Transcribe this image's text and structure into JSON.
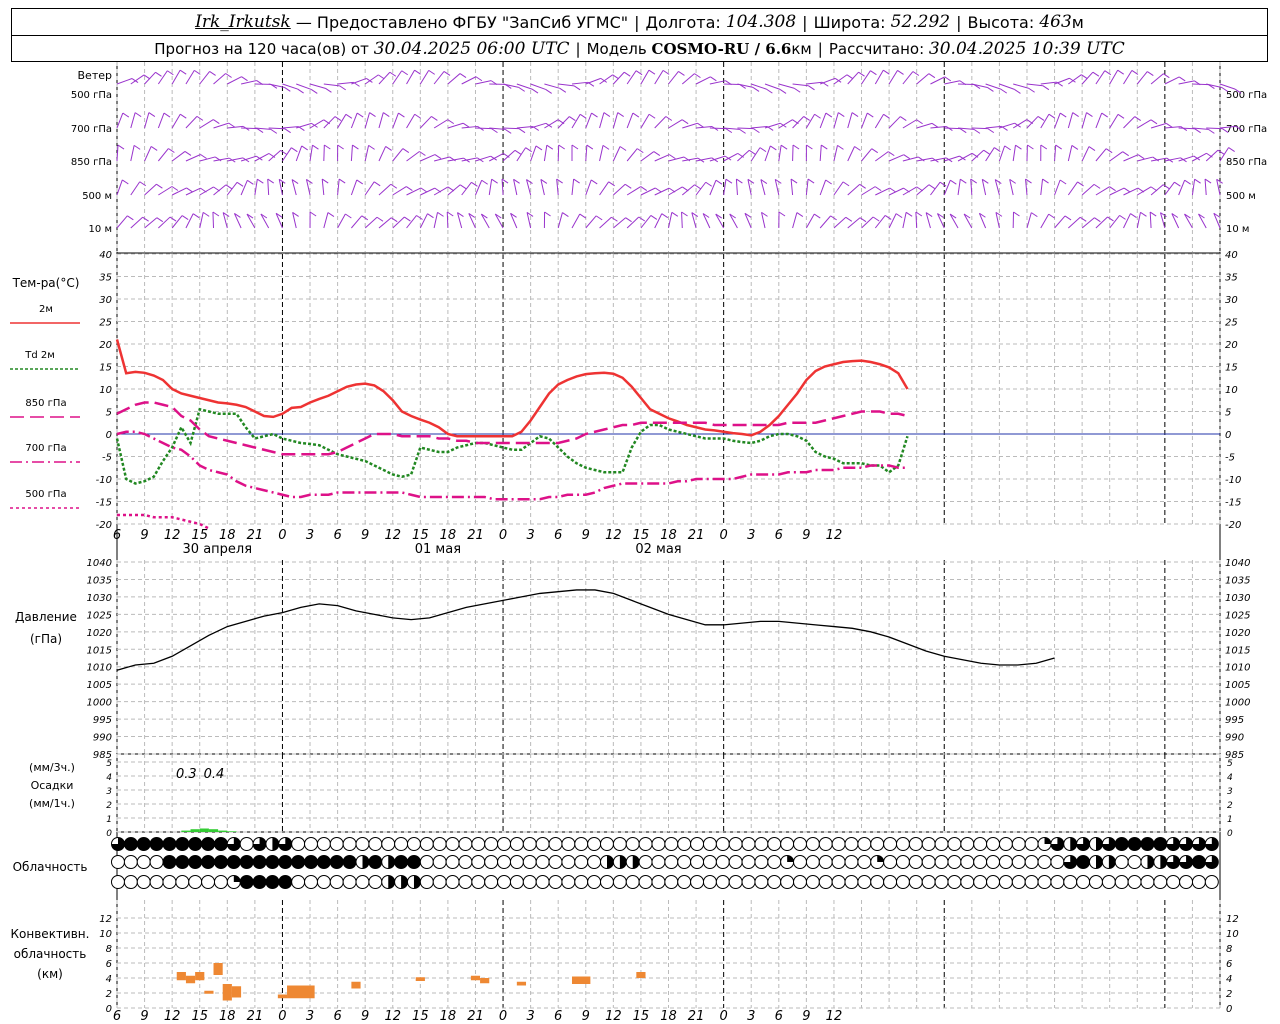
{
  "header": {
    "station": "Irk_Irkutsk",
    "sep1": " — ",
    "provider": "Предоставлено ФГБУ \"ЗапСиб УГМС\"",
    "lon_label": "Долгота:",
    "lon_value": "104.308",
    "lat_label": "Широта:",
    "lat_value": "52.292",
    "alt_label": "Высота:",
    "alt_value": "463",
    "alt_unit": "м",
    "forecast_label": "Прогноз на 120 часа(ов) от",
    "forecast_start": "30.04.2025 06:00 UTC",
    "model_label": "Модель",
    "model_name": "COSMO-RU / 6.6",
    "model_unit": "км",
    "computed_label": "Рассчитано:",
    "computed_time": "30.04.2025 10:39 UTC"
  },
  "time_axis": {
    "hour_labels": [
      "6",
      "9",
      "12",
      "15",
      "18",
      "21",
      "0",
      "3",
      "6",
      "9",
      "12",
      "15",
      "18",
      "21",
      "0",
      "3",
      "6",
      "9",
      "12",
      "15",
      "18",
      "21",
      "0",
      "3",
      "6",
      "9",
      "12"
    ],
    "day_labels": [
      "30 апреля",
      "01 мая",
      "02 мая"
    ]
  },
  "wind_panel": {
    "title": "Ветер",
    "levels": [
      "500 гПа",
      "700 гПа",
      "850 гПа",
      "500 м",
      "10 м"
    ],
    "colors": {
      "barb": "#9933cc"
    }
  },
  "chart_data": [
    {
      "type": "line",
      "title": "Тем-ра(°C)",
      "x_hours": [
        6,
        7,
        8,
        9,
        10,
        11,
        12,
        13,
        14,
        15,
        16,
        17,
        18,
        19,
        20,
        21,
        22,
        23,
        24,
        25,
        26,
        27,
        28,
        29,
        30,
        31,
        32,
        33,
        34,
        35,
        36,
        37,
        38,
        39,
        40,
        41,
        42,
        43,
        44,
        45,
        46,
        47,
        48,
        49,
        50,
        51,
        52,
        53,
        54,
        55,
        56,
        57,
        58,
        59,
        60,
        61,
        62,
        63,
        64,
        65,
        66,
        67,
        68,
        69,
        70,
        71,
        72,
        73,
        74,
        75,
        76,
        77,
        78,
        79,
        80,
        81,
        82,
        83,
        84,
        85,
        86,
        87,
        88,
        89,
        90,
        91,
        92,
        93,
        94,
        95,
        96,
        97,
        98,
        99,
        100,
        101,
        102,
        103,
        104,
        105,
        106,
        107,
        108,
        109,
        110,
        111,
        112,
        113,
        114,
        115,
        116,
        117,
        118,
        119,
        120,
        121,
        122,
        123,
        124,
        125,
        126
      ],
      "ylim": [
        -20,
        40
      ],
      "yticks": [
        -20,
        -15,
        -10,
        -5,
        0,
        5,
        10,
        15,
        20,
        25,
        30,
        35,
        40
      ],
      "series": [
        {
          "name": "2м",
          "color": "#ee3333",
          "dash": "solid",
          "values": [
            21,
            13.5,
            13.8,
            13.6,
            13,
            12,
            10,
            9,
            8.5,
            8,
            7.5,
            7,
            6.8,
            6.5,
            6,
            5,
            4,
            3.8,
            4.5,
            5.8,
            6,
            7,
            7.8,
            8.5,
            9.5,
            10.5,
            11,
            11.2,
            10.8,
            9.5,
            7.5,
            5,
            4,
            3.2,
            2.5,
            1.5,
            0,
            -0.5,
            -0.5,
            -0.5,
            -0.5,
            -0.5,
            -0.5,
            -0.5,
            0.5,
            3,
            6,
            9,
            11,
            12,
            12.8,
            13.3,
            13.5,
            13.6,
            13.4,
            12.5,
            10.5,
            8,
            5.5,
            4.5,
            3.5,
            2.8,
            2,
            1.5,
            1,
            0.8,
            0.5,
            0.2,
            0,
            -0.3,
            0.5,
            2,
            4,
            6.5,
            9,
            12,
            14,
            15,
            15.5,
            16,
            16.2,
            16.3,
            16,
            15.5,
            14.8,
            13.5,
            10
          ]
        },
        {
          "name": "Td 2м",
          "color": "#228822",
          "dash": "3,2",
          "values": [
            -1,
            -10,
            -11,
            -10.5,
            -9.5,
            -6,
            -3,
            1.5,
            -2,
            5.5,
            5,
            4.5,
            4.5,
            4.5,
            1.5,
            -1,
            -0.5,
            0,
            -1,
            -1.5,
            -2,
            -2.2,
            -2.5,
            -3.5,
            -4.5,
            -5,
            -5.5,
            -6,
            -7,
            -8,
            -9,
            -9.5,
            -9,
            -3,
            -3.5,
            -4,
            -4,
            -3,
            -2.5,
            -2,
            -2,
            -2.5,
            -3,
            -3.5,
            -3.5,
            -2,
            -0.5,
            -1,
            -3,
            -5,
            -6.5,
            -7.5,
            -8,
            -8.5,
            -8.5,
            -8.5,
            -3,
            0.5,
            2,
            2,
            1,
            0.5,
            0,
            -0.5,
            -1,
            -1,
            -1,
            -1.5,
            -1.8,
            -2,
            -1.5,
            -0.5,
            0,
            0,
            -0.5,
            -1.5,
            -4,
            -5,
            -5.5,
            -6.5,
            -6.5,
            -6.5,
            -7,
            -7,
            -8.5,
            -7,
            -0.5
          ]
        },
        {
          "name": "850 гПа",
          "color": "#dd1188",
          "dash": "14,6",
          "values": [
            4.5,
            5.5,
            6.5,
            7,
            7,
            6.5,
            6,
            4,
            3,
            1,
            -0.5,
            -1,
            -1.5,
            -2,
            -2.5,
            -3,
            -3.5,
            -4,
            -4.5,
            -4.5,
            -4.5,
            -4.5,
            -4.5,
            -4.5,
            -4,
            -3,
            -2,
            -1,
            0,
            0,
            0,
            -0.5,
            -0.5,
            -0.5,
            -0.5,
            -1,
            -1,
            -1.5,
            -1.5,
            -2,
            -2,
            -2,
            -2,
            -2,
            -2,
            -2,
            -2,
            -2,
            -2,
            -1.5,
            -1,
            0,
            0.5,
            1,
            1.5,
            2,
            2,
            2.5,
            2.5,
            2.5,
            2.5,
            2.5,
            2.5,
            2.5,
            2.5,
            2,
            2,
            2,
            2,
            2,
            2,
            2,
            2,
            2.5,
            2.5,
            2.5,
            2.5,
            3,
            3.5,
            4,
            4.5,
            5,
            5,
            5,
            4.5,
            4.5,
            4
          ]
        },
        {
          "name": "700 гПа",
          "color": "#dd1188",
          "dash": "12,4,2,4",
          "values": [
            0,
            0.5,
            0.5,
            0,
            -1,
            -2,
            -3,
            -3.5,
            -5,
            -7,
            -8,
            -8.5,
            -9,
            -10.5,
            -11.5,
            -12,
            -12.5,
            -13,
            -13.5,
            -14,
            -14,
            -13.5,
            -13.5,
            -13.5,
            -13,
            -13,
            -13,
            -13,
            -13,
            -13,
            -13,
            -13,
            -13.5,
            -14,
            -14,
            -14,
            -14,
            -14,
            -14,
            -14,
            -14,
            -14.5,
            -14.5,
            -14.5,
            -14.5,
            -14.5,
            -14.5,
            -14,
            -14,
            -13.5,
            -13.5,
            -13.5,
            -13,
            -12,
            -11.5,
            -11,
            -11,
            -11,
            -11,
            -11,
            -11,
            -10.5,
            -10.5,
            -10,
            -10,
            -10,
            -10,
            -10,
            -9.5,
            -9,
            -9,
            -9,
            -9,
            -8.5,
            -8.5,
            -8.5,
            -8,
            -8,
            -8,
            -7.5,
            -7.5,
            -7.5,
            -7,
            -7,
            -7,
            -7.5,
            -7.5
          ]
        },
        {
          "name": "500 гПа",
          "color": "#dd1188",
          "dash": "3,3",
          "values": [
            -18,
            -18,
            -18,
            -18,
            -18.5,
            -18.5,
            -18.5,
            -19,
            -19.5,
            -20,
            -21
          ]
        }
      ]
    },
    {
      "type": "line",
      "title": "Давление",
      "unit": "(гПа)",
      "x_hours": [
        6,
        8,
        10,
        12,
        14,
        16,
        18,
        20,
        22,
        24,
        26,
        28,
        30,
        32,
        34,
        36,
        38,
        40,
        42,
        44,
        46,
        48,
        50,
        52,
        54,
        56,
        58,
        60,
        62,
        64,
        66,
        68,
        70,
        72,
        74,
        76,
        78,
        80,
        82,
        84,
        86,
        88,
        90,
        92,
        94,
        96,
        98,
        100,
        102,
        104,
        106,
        108,
        110,
        112,
        114,
        116,
        118,
        120,
        122,
        124,
        126
      ],
      "ylim": [
        985,
        1040
      ],
      "yticks": [
        985,
        990,
        995,
        1000,
        1005,
        1010,
        1015,
        1020,
        1025,
        1030,
        1035,
        1040
      ],
      "series": [
        {
          "name": "",
          "color": "#000000",
          "values": [
            1009,
            1010.5,
            1011,
            1013,
            1016,
            1019,
            1021.5,
            1023,
            1024.5,
            1025.5,
            1027,
            1028,
            1027.5,
            1026,
            1025,
            1024,
            1023.5,
            1024,
            1025.5,
            1027,
            1028,
            1029,
            1030,
            1031,
            1031.5,
            1032,
            1032,
            1031,
            1029,
            1027,
            1025,
            1023.5,
            1022,
            1022,
            1022.5,
            1023,
            1023,
            1022.5,
            1022,
            1021.5,
            1021,
            1020,
            1018.5,
            1016.5,
            1014.5,
            1013,
            1012,
            1011,
            1010.5,
            1010.5,
            1011,
            1012.5
          ]
        }
      ]
    },
    {
      "type": "bar",
      "title": "Осадки",
      "unit_top": "(мм/3ч.)",
      "unit_bottom": "(мм/1ч.)",
      "ylim": [
        0,
        5
      ],
      "yticks": [
        0,
        1,
        2,
        3,
        4,
        5
      ],
      "labels": [
        {
          "hour": 13,
          "text": "0.3"
        },
        {
          "hour": 16,
          "text": "0.4"
        }
      ],
      "bars": [
        {
          "h1": 13,
          "h2": 14,
          "value": 0.1
        },
        {
          "h1": 14,
          "h2": 15,
          "value": 0.2
        },
        {
          "h1": 15,
          "h2": 16,
          "value": 0.25
        },
        {
          "h1": 16,
          "h2": 17,
          "value": 0.2
        },
        {
          "h1": 17,
          "h2": 18,
          "value": 0.1
        },
        {
          "h1": 18,
          "h2": 19,
          "value": 0.05
        }
      ],
      "color": "#33cc33"
    },
    {
      "type": "table",
      "title": "Облачность",
      "rows_fraction": [
        [
          0.75,
          1,
          1,
          1,
          1,
          1,
          1,
          1,
          1,
          0.75,
          0,
          0.75,
          0.5,
          0.75,
          0,
          0,
          0,
          0,
          0,
          0,
          0,
          0,
          0,
          0,
          0,
          0,
          0,
          0,
          0,
          0,
          0,
          0,
          0,
          0,
          0,
          0,
          0,
          0,
          0,
          0,
          0,
          0,
          0,
          0,
          0,
          0,
          0,
          0,
          0,
          0,
          0,
          0,
          0,
          0,
          0,
          0,
          0,
          0,
          0,
          0,
          0,
          0,
          0,
          0,
          0,
          0,
          0,
          0,
          0,
          0,
          0,
          0,
          0.25,
          0.75,
          0.5,
          0.75,
          0.5,
          0.75,
          1,
          1,
          1,
          1,
          0.75,
          0.75,
          0.75,
          0.75,
          0.75
        ],
        [
          0,
          0,
          0,
          0,
          1,
          1,
          1,
          1,
          1,
          1,
          1,
          1,
          1,
          1,
          1,
          1,
          1,
          1,
          1,
          0.5,
          1,
          0.5,
          1,
          1,
          0,
          0,
          0,
          0,
          0,
          0,
          0,
          0,
          0,
          0,
          0,
          0,
          0,
          0,
          0.5,
          0.5,
          0.5,
          0,
          0,
          0,
          0,
          0,
          0,
          0,
          0,
          0,
          0,
          0,
          0.25,
          0,
          0,
          0,
          0,
          0,
          0,
          0.25,
          0,
          0,
          0,
          0,
          0,
          0,
          0,
          0,
          0,
          0,
          0,
          0,
          0,
          0,
          0.75,
          1,
          0.5,
          0.5,
          0,
          0,
          0.5,
          0.5,
          0.75,
          0.75,
          1,
          0.75,
          0.25,
          0.75,
          0.75,
          0.5
        ],
        [
          0,
          0,
          0,
          0,
          0,
          0,
          0,
          0,
          0,
          0.25,
          1,
          1,
          1,
          1,
          0,
          0,
          0,
          0,
          0,
          0,
          0,
          0.5,
          0.5,
          0.5,
          0,
          0,
          0,
          0,
          0,
          0,
          0,
          0,
          0,
          0,
          0,
          0,
          0,
          0,
          0,
          0,
          0,
          0,
          0,
          0,
          0,
          0,
          0,
          0,
          0,
          0,
          0,
          0,
          0,
          0,
          0,
          0,
          0,
          0,
          0,
          0,
          0,
          0,
          0,
          0,
          0,
          0,
          0,
          0,
          0,
          0,
          0,
          0,
          0,
          0,
          0,
          0,
          0,
          0,
          0,
          0,
          0,
          0,
          0,
          0,
          0,
          0,
          0
        ]
      ]
    },
    {
      "type": "bar",
      "title": "Конвективн. облачность",
      "unit": "(км)",
      "ylim": [
        0,
        14
      ],
      "yticks": [
        0,
        2,
        4,
        6,
        8,
        10,
        12
      ],
      "color": "#ee8833",
      "blocks": [
        {
          "h1": 12.5,
          "h2": 13.5,
          "bottom": 3.7,
          "top": 4.8
        },
        {
          "h1": 13.5,
          "h2": 14.5,
          "bottom": 3.3,
          "top": 4.3
        },
        {
          "h1": 14.5,
          "h2": 15.5,
          "bottom": 3.7,
          "top": 4.8
        },
        {
          "h1": 15.5,
          "h2": 16.5,
          "bottom": 1.9,
          "top": 2.3
        },
        {
          "h1": 16.5,
          "h2": 17.5,
          "bottom": 4.4,
          "top": 6.0
        },
        {
          "h1": 17.5,
          "h2": 18.5,
          "bottom": 1.0,
          "top": 3.2
        },
        {
          "h1": 18.5,
          "h2": 19.5,
          "bottom": 1.4,
          "top": 2.9
        },
        {
          "h1": 23.5,
          "h2": 24.5,
          "bottom": 1.3,
          "top": 1.8
        },
        {
          "h1": 24.5,
          "h2": 27.5,
          "bottom": 1.3,
          "top": 3.0
        },
        {
          "h1": 31.5,
          "h2": 32.5,
          "bottom": 2.6,
          "top": 3.5
        },
        {
          "h1": 38.5,
          "h2": 39.5,
          "bottom": 3.6,
          "top": 4.1
        },
        {
          "h1": 44.5,
          "h2": 45.5,
          "bottom": 3.7,
          "top": 4.3
        },
        {
          "h1": 45.5,
          "h2": 46.5,
          "bottom": 3.3,
          "top": 4.0
        },
        {
          "h1": 49.5,
          "h2": 50.5,
          "bottom": 3.0,
          "top": 3.5
        },
        {
          "h1": 55.5,
          "h2": 57.5,
          "bottom": 3.2,
          "top": 4.2
        },
        {
          "h1": 62.5,
          "h2": 63.5,
          "bottom": 4.0,
          "top": 4.8
        }
      ]
    }
  ]
}
